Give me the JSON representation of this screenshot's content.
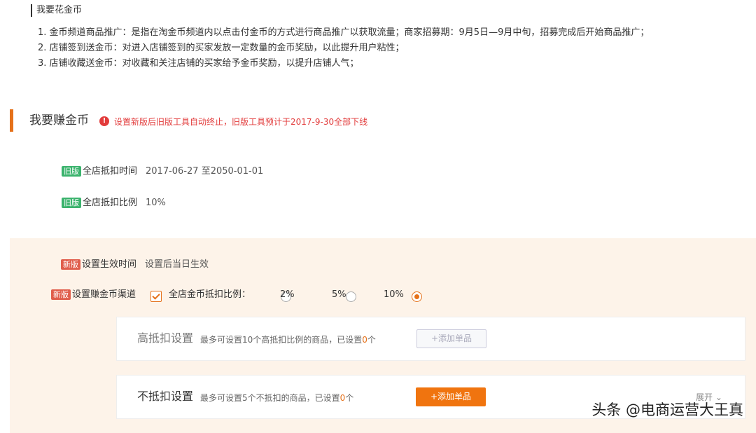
{
  "spend": {
    "title": "我要花金币",
    "items": [
      "1. 金币频道商品推广：是指在淘金币频道内以点击付金币的方式进行商品推广以获取流量；商家招募期：9月5日—9月中旬，招募完成后开始商品推广；",
      "2. 店铺签到送金币：对进入店铺签到的买家发放一定数量的金币奖励，以此提升用户粘性；",
      "3. 店铺收藏送金币：对收藏和关注店铺的买家给予金币奖励，以提升店铺人气；"
    ]
  },
  "earn": {
    "title": "我要赚金币",
    "warning_icon": "!",
    "warning": "设置新版后旧版工具自动终止，旧版工具预计于2017-9-30全部下线"
  },
  "old": {
    "tag": "旧版",
    "rows": [
      {
        "label": "全店抵扣时间",
        "value": "2017-06-27 至2050-01-01"
      },
      {
        "label": "全店抵扣比例",
        "value": "10%"
      }
    ]
  },
  "new": {
    "tag": "新版",
    "effective_label": "设置生效时间",
    "effective_value": "设置后当日生效",
    "channel_label": "设置赚金币渠道",
    "checkbox_label": "全店金币抵扣比例：",
    "options": [
      "2%",
      "5%",
      "10%"
    ],
    "selected": "10%",
    "high": {
      "title": "高抵扣设置",
      "desc_prefix": "最多可设置10个高抵扣比例的商品，已设置",
      "count": "0",
      "desc_suffix": "个",
      "button": "+添加单品"
    },
    "none": {
      "title": "不抵扣设置",
      "desc_prefix": "最多可设置5个不抵扣的商品，已设置",
      "count": "0",
      "desc_suffix": "个",
      "button": "+添加单品",
      "expand": "展开"
    }
  },
  "watermark": "头条 @电商运营大王真",
  "colors": {
    "accent": "#f0740f",
    "warning": "#e23b3b",
    "old_tag": "#3bb36d",
    "new_tag": "#e05d4b",
    "panel_bg": "#fdf3e9"
  }
}
